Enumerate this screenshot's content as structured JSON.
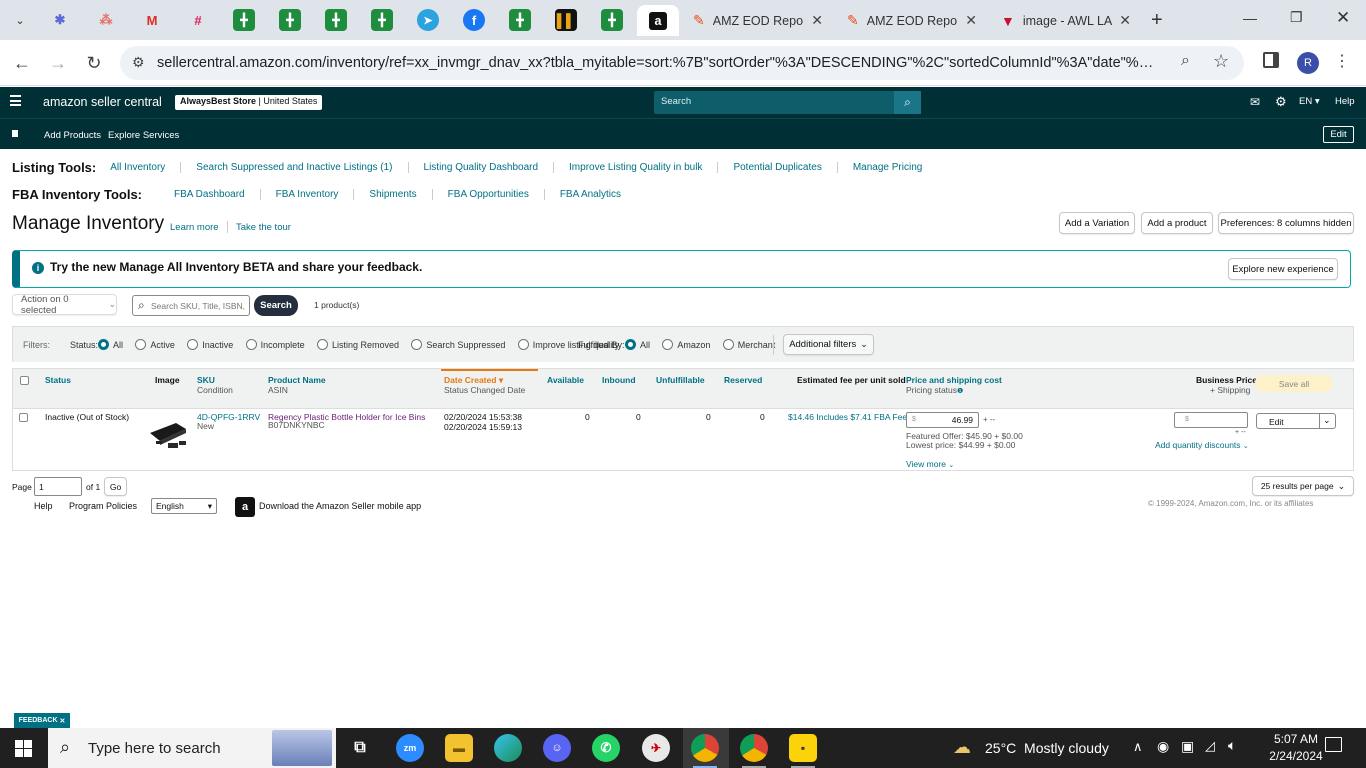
{
  "browser": {
    "pinned_icons": [
      "notion-icon",
      "asana-icon",
      "gmail-icon",
      "slack-icon",
      "sheets-icon",
      "sheets-icon",
      "sheets-icon",
      "sheets-icon",
      "telegram-icon",
      "facebook-icon",
      "sheets-icon",
      "app-icon",
      "sheets-icon",
      "amazon-icon"
    ],
    "tabs": [
      {
        "title": "AMZ EOD Repo"
      },
      {
        "title": "AMZ EOD Repo"
      },
      {
        "title": "image - AWL LA"
      }
    ],
    "url": "sellercentral.amazon.com/inventory/ref=xx_invmgr_dnav_xx?tbla_myitable=sort:%7B\"sortOrder\"%3A\"DESCENDING\"%2C\"sortedColumnId\"%3A\"date\"%7D;search:;p...",
    "profile_initial": "R"
  },
  "header": {
    "logo_text": "amazon seller central",
    "store_name": "AlwaysBest Store",
    "store_region": "United States",
    "search_placeholder": "Search",
    "language": "EN",
    "help": "Help"
  },
  "subnav": {
    "add_products": "Add Products",
    "explore_services": "Explore Services",
    "edit": "Edit"
  },
  "listing_tools": {
    "label": "Listing Tools:",
    "items": [
      "All Inventory",
      "Search Suppressed and Inactive Listings (1)",
      "Listing Quality Dashboard",
      "Improve Listing Quality in bulk",
      "Potential Duplicates",
      "Manage Pricing"
    ]
  },
  "fba_tools": {
    "label": "FBA Inventory Tools:",
    "items": [
      "FBA Dashboard",
      "FBA Inventory",
      "Shipments",
      "FBA Opportunities",
      "FBA Analytics"
    ]
  },
  "page": {
    "title": "Manage Inventory",
    "learn_more": "Learn more",
    "take_tour": "Take the tour",
    "add_variation": "Add a Variation",
    "add_product": "Add a product",
    "preferences": "Preferences: 8 columns hidden"
  },
  "banner": {
    "text": "Try the new Manage All Inventory BETA and share your feedback.",
    "button": "Explore new experience"
  },
  "search": {
    "action": "Action on 0 selected",
    "placeholder": "Search SKU, Title, ISBN,",
    "button": "Search",
    "count": "1 product(s)"
  },
  "filters": {
    "label": "Filters:",
    "status_label": "Status:",
    "status_options": [
      "All",
      "Active",
      "Inactive",
      "Incomplete",
      "Listing Removed",
      "Search Suppressed",
      "Improve listing quality"
    ],
    "fulfilled_label": "Fulfilled By:",
    "fulfilled_options": [
      "All",
      "Amazon",
      "Merchant"
    ],
    "additional": "Additional filters"
  },
  "table": {
    "headers": {
      "status": "Status",
      "image": "Image",
      "sku": "SKU",
      "condition": "Condition",
      "product_name": "Product Name",
      "asin": "ASIN",
      "date_created": "Date Created",
      "status_changed": "Status Changed Date",
      "available": "Available",
      "inbound": "Inbound",
      "unfulfillable": "Unfulfillable",
      "reserved": "Reserved",
      "est_fee": "Estimated fee per unit sold",
      "price_shipping": "Price and shipping cost",
      "pricing_status": "Pricing status",
      "business_price": "Business Price",
      "plus_shipping": "+ Shipping",
      "save_all": "Save all"
    },
    "row": {
      "status": "Inactive (Out of Stock)",
      "sku": "4D-QPFG-1RRV",
      "condition": "New",
      "product_name": "Regency Plastic Bottle Holder for Ice Bins",
      "asin": "B07DNKYNBC",
      "date_created": "02/20/2024 15:53:38",
      "status_changed": "02/20/2024 15:59:13",
      "available": "0",
      "inbound": "0",
      "unfulfillable": "0",
      "reserved": "0",
      "est_fee": "$14.46 Includes $7.41 FBA Fee",
      "price": "46.99",
      "currency": "$",
      "price_suffix": "+ --",
      "featured_offer": "Featured Offer: $45.90 + $0.00",
      "lowest_price": "Lowest price: $44.99 + $0.00",
      "view_more": "View more",
      "business_currency": "$",
      "business_suffix": "+ --",
      "add_qty_discounts": "Add quantity discounts",
      "edit": "Edit"
    }
  },
  "pagination": {
    "page_label": "Page",
    "page_value": "1",
    "of": "of 1",
    "go": "Go",
    "per_page": "25 results per page"
  },
  "footer": {
    "help": "Help",
    "program_policies": "Program Policies",
    "language": "English",
    "download_app": "Download the Amazon Seller mobile app",
    "copyright": "© 1999-2024, Amazon.com, Inc. or its affiliates",
    "feedback": "FEEDBACK"
  },
  "taskbar": {
    "search_placeholder": "Type here to search",
    "weather": "25°C  Mostly cloudy",
    "time": "5:07 AM",
    "date": "2/24/2024"
  },
  "colors": {
    "header_bg": "#002f36",
    "link": "#007185",
    "accent_orange": "#e47911"
  }
}
